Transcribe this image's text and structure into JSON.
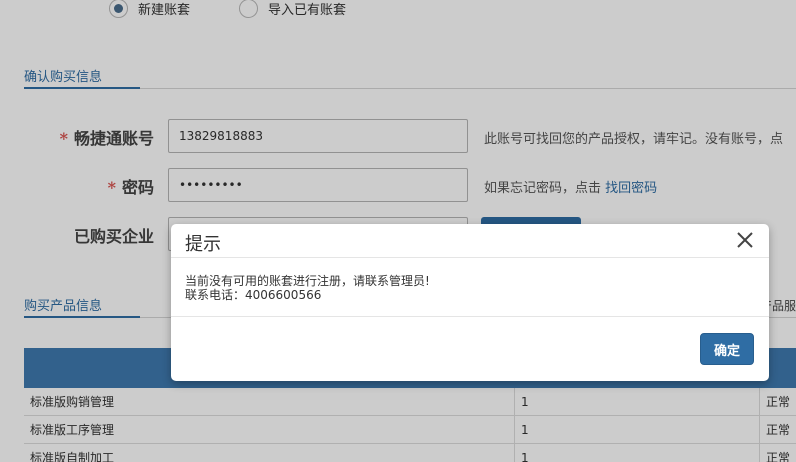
{
  "account_mode": {
    "options": [
      {
        "label": "新建账套",
        "checked": true
      },
      {
        "label": "导入已有账套",
        "checked": false
      }
    ]
  },
  "sections": {
    "confirm": "确认购买信息",
    "products": "购买产品信息"
  },
  "form": {
    "account_label": "畅捷通账号",
    "account_value": "13829818883",
    "account_hint": "此账号可找回您的产品授权，请牢记。没有账号，点",
    "password_label": "密码",
    "password_value": "•••••••••",
    "password_hint_prefix": "如果忘记密码，点击",
    "password_hint_link": "找回密码",
    "company_label": "已购买企业",
    "required_mark": "*"
  },
  "side_text": "产品服",
  "table": {
    "rows": [
      {
        "name": "标准版购销管理",
        "qty": "1",
        "status": "正常"
      },
      {
        "name": "标准版工序管理",
        "qty": "1",
        "status": "正常"
      },
      {
        "name": "标准版自制加工",
        "qty": "1",
        "status": "正常"
      }
    ]
  },
  "dialog": {
    "title": "提示",
    "message_line1": "当前没有可用的账套进行注册，请联系管理员!",
    "message_line2": "联系电话：4006600566",
    "ok_label": "确定",
    "close_icon": "close-icon"
  },
  "colors": {
    "accent": "#2f6da4",
    "required": "#d9534f",
    "table_header": "#3f7ab0"
  }
}
